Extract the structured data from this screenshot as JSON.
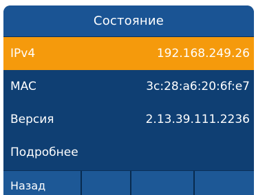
{
  "header": {
    "title": "Состояние"
  },
  "status_list": {
    "items": [
      {
        "label": "IPv4",
        "value": "192.168.249.26",
        "selected": true
      },
      {
        "label": "MAC",
        "value": "3c:28:a6:20:6f:e7",
        "selected": false
      },
      {
        "label": "Версия",
        "value": "2.13.39.111.2236",
        "selected": false
      },
      {
        "label": "Подробнее",
        "value": "",
        "selected": false
      }
    ]
  },
  "softkeys": [
    {
      "label": "Назад"
    },
    {
      "label": ""
    },
    {
      "label": ""
    },
    {
      "label": ""
    }
  ],
  "colors": {
    "background": "#0f3f73",
    "title_bar": "#1a5494",
    "selection": "#f59a0c",
    "softkey": "#1d5896",
    "text": "#ffffff"
  }
}
